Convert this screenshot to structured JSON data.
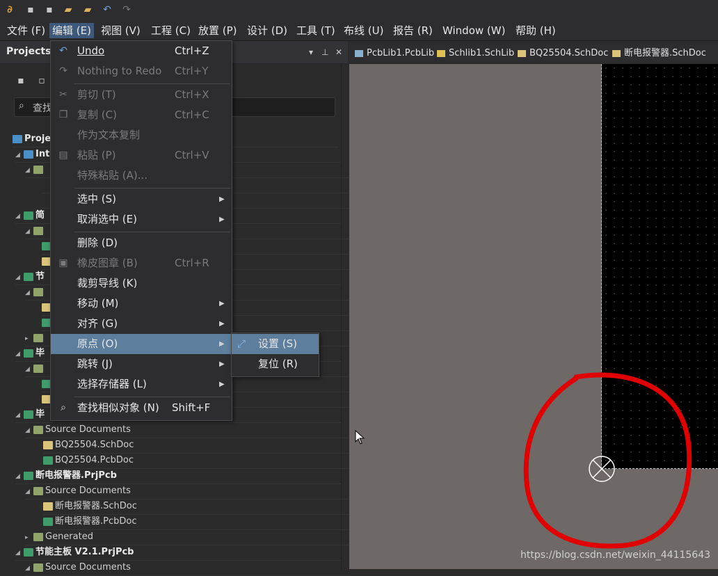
{
  "menubar": {
    "items": [
      "文件 (F)",
      "编辑 (E)",
      "视图 (V)",
      "工程 (C)",
      "放置 (P)",
      "设计 (D)",
      "工具 (T)",
      "布线 (U)",
      "报告 (R)",
      "Window (W)",
      "帮助 (H)"
    ]
  },
  "panel": {
    "title": "Projects",
    "search_text": "查找",
    "tree": [
      {
        "label": "Proje",
        "bold": true
      },
      {
        "label": "Int",
        "bold": true
      },
      {
        "label": "简",
        "bold": true
      },
      {
        "label": "节",
        "bold": true
      },
      {
        "label": "毕",
        "bold": true
      },
      {
        "label": "毕",
        "bold": true
      },
      {
        "label": "Source Documents"
      },
      {
        "label": "BQ25504.SchDoc"
      },
      {
        "label": "BQ25504.PcbDoc"
      },
      {
        "label": "断电报警器.PrjPcb",
        "bold": true
      },
      {
        "label": "Source Documents"
      },
      {
        "label": "断电报警器.SchDoc"
      },
      {
        "label": "断电报警器.PcbDoc"
      },
      {
        "label": "Generated"
      },
      {
        "label": "节能主板 V2.1.PrjPcb",
        "bold": true
      },
      {
        "label": "Source Documents"
      }
    ]
  },
  "tabs": [
    "PcbLib1.PcbLib",
    "Schlib1.SchLib",
    "BQ25504.SchDoc",
    "断电报警器.SchDoc"
  ],
  "edit_menu": {
    "items": [
      {
        "label": "Undo",
        "shortcut": "Ctrl+Z"
      },
      {
        "label": "Nothing to Redo",
        "shortcut": "Ctrl+Y"
      },
      {
        "label": "剪切 (T)",
        "shortcut": "Ctrl+X"
      },
      {
        "label": "复制 (C)",
        "shortcut": "Ctrl+C"
      },
      {
        "label": "作为文本复制",
        "shortcut": ""
      },
      {
        "label": "粘贴 (P)",
        "shortcut": "Ctrl+V"
      },
      {
        "label": "特殊粘贴 (A)...",
        "shortcut": ""
      },
      {
        "label": "选中 (S)",
        "shortcut": ""
      },
      {
        "label": "取消选中 (E)",
        "shortcut": ""
      },
      {
        "label": "删除 (D)",
        "shortcut": ""
      },
      {
        "label": "橡皮图章 (B)",
        "shortcut": "Ctrl+R"
      },
      {
        "label": "裁剪导线 (K)",
        "shortcut": ""
      },
      {
        "label": "移动 (M)",
        "shortcut": ""
      },
      {
        "label": "对齐 (G)",
        "shortcut": ""
      },
      {
        "label": "原点 (O)",
        "shortcut": ""
      },
      {
        "label": "跳转 (J)",
        "shortcut": ""
      },
      {
        "label": "选择存储器 (L)",
        "shortcut": ""
      },
      {
        "label": "查找相似对象 (N)",
        "shortcut": "Shift+F"
      }
    ]
  },
  "origin_submenu": {
    "items": [
      {
        "label": "设置 (S)"
      },
      {
        "label": "复位 (R)"
      }
    ]
  },
  "watermark": "https://blog.csdn.net/weixin_44115643",
  "colors": {
    "menu_highlight": "#5e7e9e",
    "annotation": "#e00000",
    "sheet": "#000000",
    "canvas": "#6e6867"
  }
}
